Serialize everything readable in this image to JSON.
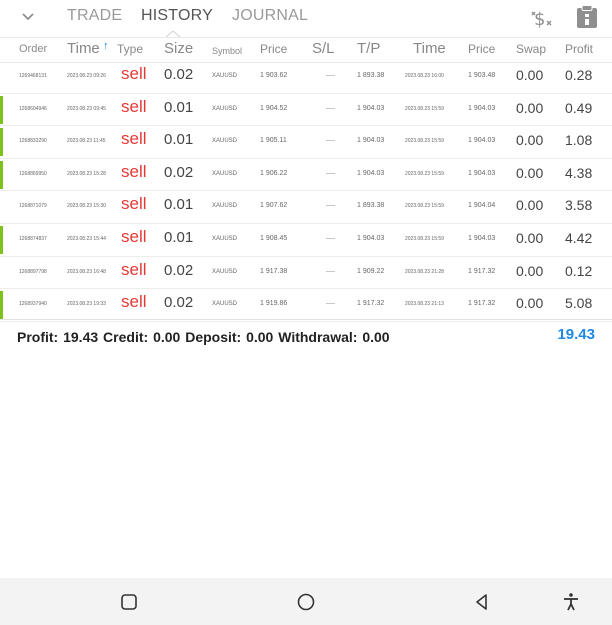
{
  "tabs": [
    "TRADE",
    "HISTORY",
    "JOURNAL"
  ],
  "active_tab": "HISTORY",
  "columns": {
    "order": "Order",
    "time": "Time",
    "sort_arrow": "↑",
    "type": "Type",
    "size": "Size",
    "symbol": "Symbol",
    "price": "Price",
    "sl": "S/L",
    "tp": "T/P",
    "close_time": "Time",
    "close_price": "Price",
    "swap": "Swap",
    "profit": "Profit"
  },
  "rows": [
    {
      "order": "1269468131",
      "open_time": "2023.08.23 09:26",
      "type": "sell",
      "size": "0.02",
      "symbol": "XAUUSD",
      "price": "1 903.62",
      "tp": "1 893.38",
      "close_time": "2023.08.23 16:00",
      "close_price": "1 903.48",
      "swap": "0.00",
      "profit": "0.28"
    },
    {
      "order": "1268604946",
      "open_time": "2023.08.23 09:45",
      "type": "sell",
      "size": "0.01",
      "symbol": "XAUUSD",
      "price": "1 904.52",
      "tp": "1 904.03",
      "close_time": "2023.08.23 15:59",
      "close_price": "1 904.03",
      "swap": "0.00",
      "profit": "0.49"
    },
    {
      "order": "1268833290",
      "open_time": "2023.08.23 11:45",
      "type": "sell",
      "size": "0.01",
      "symbol": "XAUUSD",
      "price": "1 905.11",
      "tp": "1 904.03",
      "close_time": "2023.08.23 15:59",
      "close_price": "1 904.03",
      "swap": "0.00",
      "profit": "1.08"
    },
    {
      "order": "1268869950",
      "open_time": "2023.08.23 15:28",
      "type": "sell",
      "size": "0.02",
      "symbol": "XAUUSD",
      "price": "1 906.22",
      "tp": "1 904.03",
      "close_time": "2023.08.23 15:59",
      "close_price": "1 904.03",
      "swap": "0.00",
      "profit": "4.38"
    },
    {
      "order": "1268871079",
      "open_time": "2023.08.23 15:30",
      "type": "sell",
      "size": "0.01",
      "symbol": "XAUUSD",
      "price": "1 907.62",
      "tp": "1 893.38",
      "close_time": "2023.08.23 15:59",
      "close_price": "1 904.04",
      "swap": "0.00",
      "profit": "3.58"
    },
    {
      "order": "1268874837",
      "open_time": "2023.08.23 15:44",
      "type": "sell",
      "size": "0.01",
      "symbol": "XAUUSD",
      "price": "1 908.45",
      "tp": "1 904.03",
      "close_time": "2023.08.23 15:59",
      "close_price": "1 904.03",
      "swap": "0.00",
      "profit": "4.42"
    },
    {
      "order": "1268897798",
      "open_time": "2023.08.23 16:48",
      "type": "sell",
      "size": "0.02",
      "symbol": "XAUUSD",
      "price": "1 917.38",
      "tp": "1 909.22",
      "close_time": "2023.08.23 21:28",
      "close_price": "1 917.32",
      "swap": "0.00",
      "profit": "0.12"
    },
    {
      "order": "1268937940",
      "open_time": "2023.08.23 19:33",
      "type": "sell",
      "size": "0.02",
      "symbol": "XAUUSD",
      "price": "1 919.86",
      "tp": "1 917.32",
      "close_time": "2023.08.23 21:13",
      "close_price": "1 917.32",
      "swap": "0.00",
      "profit": "5.08"
    }
  ],
  "row_markers": [
    false,
    true,
    true,
    true,
    false,
    true,
    false,
    true
  ],
  "summary": {
    "profit_label": "Profit:",
    "profit": "19.43",
    "credit_label": "Credit:",
    "credit": "0.00",
    "deposit_label": "Deposit:",
    "deposit": "0.00",
    "withdrawal_label": "Withdrawal:",
    "withdrawal": "0.00",
    "total": "19.43"
  },
  "icons": {
    "tab_menu": "chevron-down-icon",
    "currency": "dollar-sign-icon",
    "report": "clipboard-icon",
    "nav": [
      "recents-square-icon",
      "home-circle-icon",
      "back-triangle-icon",
      "accessibility-icon"
    ]
  },
  "colors": {
    "sell": "#e53935",
    "profit_total": "#1e88e5",
    "row_marker": "#7cc21b",
    "sort_arrow": "#1e88e5"
  }
}
